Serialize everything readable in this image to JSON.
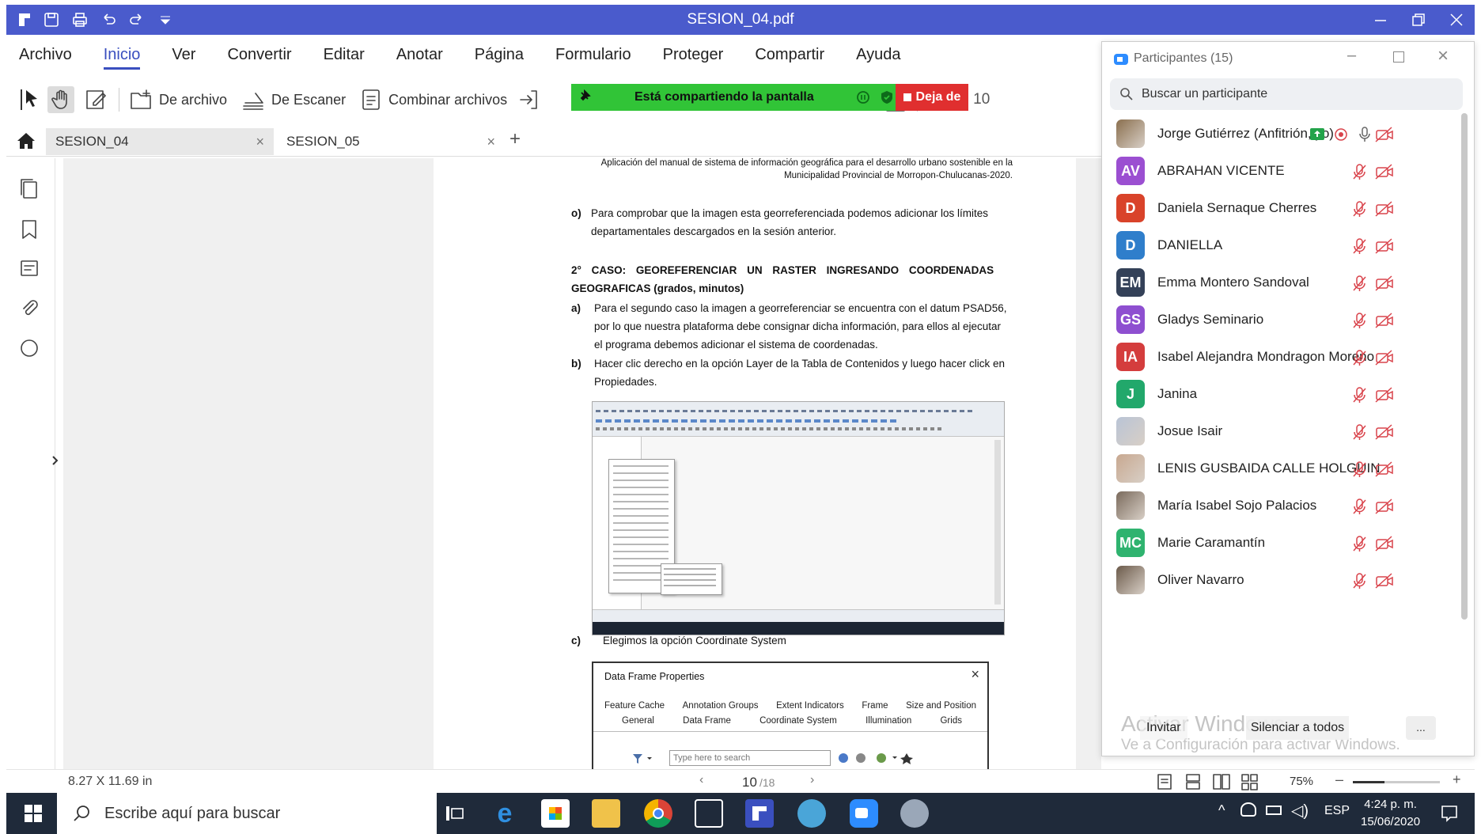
{
  "window": {
    "title": "SESION_04.pdf"
  },
  "menu": [
    "Archivo",
    "Inicio",
    "Ver",
    "Convertir",
    "Editar",
    "Anotar",
    "Página",
    "Formulario",
    "Proteger",
    "Compartir",
    "Ayuda"
  ],
  "toolbar": {
    "from_file": "De archivo",
    "from_scanner": "De Escaner",
    "combine": "Combinar archivos",
    "page_field": "10"
  },
  "sharing": {
    "banner": "Está compartiendo la pantalla",
    "stop": "Deja de"
  },
  "tabs": [
    {
      "label": "SESION_04"
    },
    {
      "label": "SESION_05"
    }
  ],
  "document": {
    "header_line1": "Aplicación del manual de sistema de información geográfica para el desarrollo urbano sostenible en la",
    "header_line2": "Municipalidad Provincial de Morropon-Chulucanas-2020.",
    "item_o_marker": "o)",
    "item_o_l1": "Para comprobar que la imagen esta georreferenciada podemos adicionar los límites",
    "item_o_l2": "departamentales descargados en la sesión anterior.",
    "case_l1": "2° CASO: GEOREFERENCIAR UN RASTER INGRESANDO COORDENADAS",
    "case_l2": "GEOGRAFICAS (grados, minutos)",
    "item_a_marker": "a)",
    "item_a_l1": "Para el segundo caso la imagen a georreferenciar se encuentra con el datum PSAD56,",
    "item_a_l2": "por lo que nuestra plataforma debe consignar dicha información, para ellos al ejecutar",
    "item_a_l3": "el programa debemos adicionar el sistema de coordenadas.",
    "item_b_marker": "b)",
    "item_b_l1": "Hacer clic derecho en la opción Layer de la Tabla de Contenidos y luego hacer click en",
    "item_b_l2": "Propiedades.",
    "item_c_marker": "c)",
    "item_c_l1": "Elegimos la opción Coordinate System",
    "dialog": {
      "title": "Data Frame Properties",
      "tabs_row1": [
        "Feature Cache",
        "Annotation Groups",
        "Extent Indicators",
        "Frame",
        "Size and Position"
      ],
      "tabs_row2": [
        "General",
        "Data Frame",
        "Coordinate System",
        "Illumination",
        "Grids"
      ],
      "search_placeholder": "Type here to search"
    }
  },
  "status": {
    "page_size": "8.27 X 11.69 in",
    "page_current": "10",
    "page_total": "/18",
    "zoom": "75%"
  },
  "participants": {
    "title": "Participantes (15)",
    "search_placeholder": "Buscar un participante",
    "list": [
      {
        "name": "Jorge Gutiérrez (Anfitrión, yo)",
        "initials": "",
        "color": "#8a6f4e",
        "photo": true
      },
      {
        "name": "ABRAHAN VICENTE",
        "initials": "AV",
        "color": "#9b4fd1"
      },
      {
        "name": "Daniela Sernaque Cherres",
        "initials": "D",
        "color": "#d9432a"
      },
      {
        "name": "DANIELLA",
        "initials": "D",
        "color": "#2f7ecb"
      },
      {
        "name": "Emma Montero Sandoval",
        "initials": "EM",
        "color": "#344158"
      },
      {
        "name": "Gladys Seminario",
        "initials": "GS",
        "color": "#8e4fd0"
      },
      {
        "name": "Isabel Alejandra Mondragon Moreno",
        "initials": "IA",
        "color": "#d43d3d"
      },
      {
        "name": "Janina",
        "initials": "J",
        "color": "#22a86b"
      },
      {
        "name": "Josue Isair",
        "initials": "",
        "color": "#b9c4d6",
        "photo": true
      },
      {
        "name": "LENIS GUSBAIDA CALLE HOLGUIN",
        "initials": "",
        "color": "#c8a890",
        "photo": true
      },
      {
        "name": "María Isabel Sojo Palacios",
        "initials": "",
        "color": "#7a6a5c",
        "photo": true
      },
      {
        "name": "Marie Caramantín",
        "initials": "MC",
        "color": "#2fb36f"
      },
      {
        "name": "Oliver Navarro",
        "initials": "",
        "color": "#6b5a4a",
        "photo": true
      }
    ],
    "invite": "Invitar",
    "mute_all": "Silenciar a todos",
    "more": "...",
    "watermark_l1": "Activar Windows",
    "watermark_l2": "Ve a Configuración para activar Windows."
  },
  "taskbar": {
    "search_placeholder": "Escribe aquí para buscar",
    "lang": "ESP",
    "time": "4:24 p. m.",
    "date": "15/06/2020"
  }
}
